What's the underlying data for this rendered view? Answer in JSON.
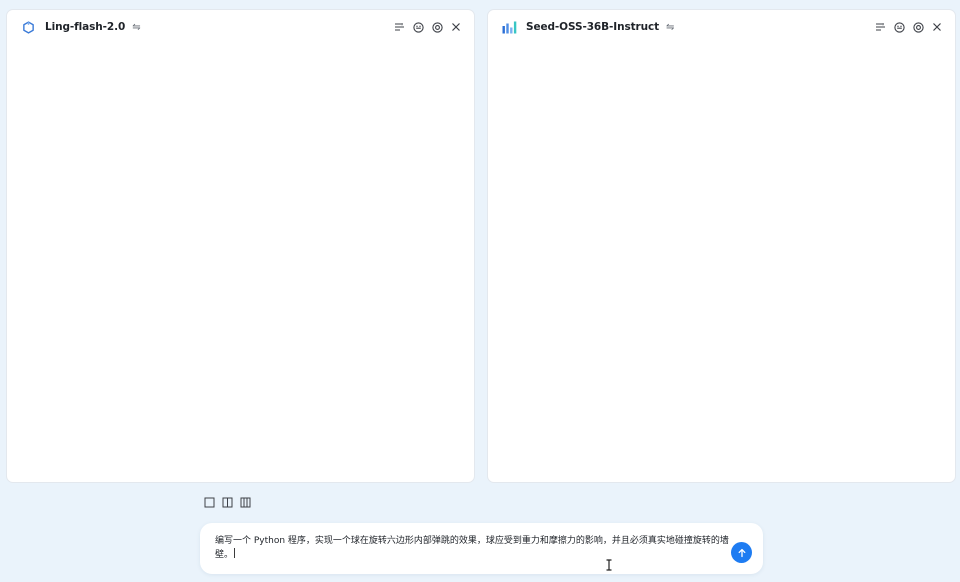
{
  "left_panel": {
    "model_name": "Ling-flash-2.0",
    "model_icon": "ling-logo-icon",
    "swap_icon": "swap-arrows-icon",
    "actions": [
      "sliders-icon",
      "ai-badge-icon",
      "settings-icon",
      "close-icon"
    ]
  },
  "right_panel": {
    "model_name": "Seed-OSS-36B-Instruct",
    "model_icon": "seed-bars-logo-icon",
    "swap_icon": "swap-arrows-icon",
    "actions": [
      "sliders-icon",
      "ai-badge-icon",
      "settings-icon",
      "close-icon"
    ]
  },
  "layout_switcher": [
    "single-column-icon",
    "two-column-icon",
    "three-column-icon"
  ],
  "prompt": {
    "text": "编写一个 Python 程序，实现一个球在旋转六边形内部弹跳的效果，球应受到重力和摩擦力的影响，并且必须真实地碰撞旋转的墙壁。",
    "send_icon": "arrow-up-icon"
  },
  "colors": {
    "background": "#eaf3fb",
    "panel": "#ffffff",
    "accent": "#1e7cf2",
    "ling_logo": "#3b7bd8",
    "seed_logo": "#2b6fd6"
  }
}
